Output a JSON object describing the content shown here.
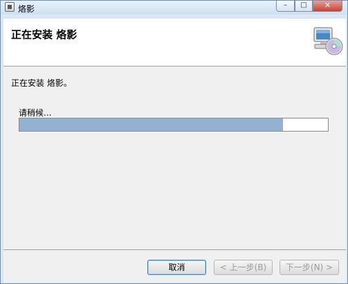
{
  "window": {
    "title": "烙影",
    "controls": {
      "minimize": "–",
      "maximize": "□",
      "close": "✕"
    }
  },
  "header": {
    "title": "正在安装 烙影",
    "icon": "computer-cd-setup-icon"
  },
  "body": {
    "status": "正在安装 烙影。",
    "wait_label": "请稍候...",
    "progress_fraction": 0.855
  },
  "buttons": {
    "cancel": "取消",
    "back": "< 上一步(B)",
    "next": "下一步(N) >"
  },
  "colors": {
    "progress_fill": "#93b1d0",
    "titlebar": "#dbe7f5",
    "close_button": "#c84030"
  }
}
